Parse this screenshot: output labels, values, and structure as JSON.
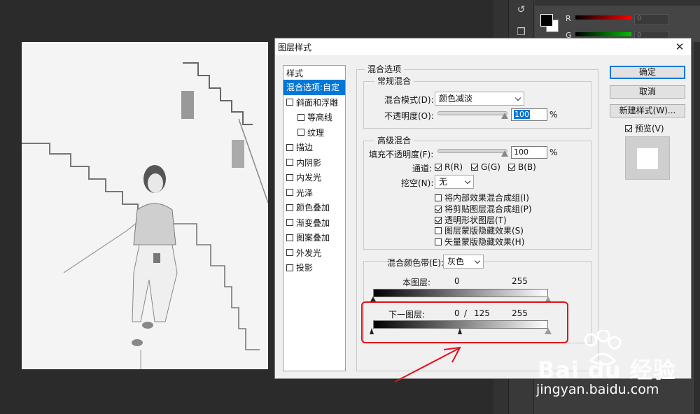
{
  "dialog": {
    "title": "图层样式",
    "close_label": "✕"
  },
  "styles_list": {
    "header": "样式",
    "items": [
      {
        "label": "混合选项:自定",
        "checkbox": false,
        "selected": true,
        "indent": false
      },
      {
        "label": "斜面和浮雕",
        "checkbox": true,
        "checked": false,
        "indent": false
      },
      {
        "label": "等高线",
        "checkbox": true,
        "checked": false,
        "indent": true
      },
      {
        "label": "纹理",
        "checkbox": true,
        "checked": false,
        "indent": true
      },
      {
        "label": "描边",
        "checkbox": true,
        "checked": false,
        "indent": false
      },
      {
        "label": "内阴影",
        "checkbox": true,
        "checked": false,
        "indent": false
      },
      {
        "label": "内发光",
        "checkbox": true,
        "checked": false,
        "indent": false
      },
      {
        "label": "光泽",
        "checkbox": true,
        "checked": false,
        "indent": false
      },
      {
        "label": "颜色叠加",
        "checkbox": true,
        "checked": false,
        "indent": false
      },
      {
        "label": "渐变叠加",
        "checkbox": true,
        "checked": false,
        "indent": false
      },
      {
        "label": "图案叠加",
        "checkbox": true,
        "checked": false,
        "indent": false
      },
      {
        "label": "外发光",
        "checkbox": true,
        "checked": false,
        "indent": false
      },
      {
        "label": "投影",
        "checkbox": true,
        "checked": false,
        "indent": false
      }
    ]
  },
  "blend_options": {
    "title": "混合选项",
    "general": {
      "title": "常规混合",
      "mode_label": "混合模式(D):",
      "mode_value": "颜色减淡",
      "opacity_label": "不透明度(O):",
      "opacity_value": "100",
      "opacity_unit": "%",
      "opacity_level": 1.0
    },
    "advanced": {
      "title": "高级混合",
      "fill_label": "填充不透明度(F):",
      "fill_value": "100",
      "fill_unit": "%",
      "fill_level": 1.0,
      "channels_label": "通道:",
      "channels": [
        {
          "label": "R(R)",
          "checked": true
        },
        {
          "label": "G(G)",
          "checked": true
        },
        {
          "label": "B(B)",
          "checked": true
        }
      ],
      "knockout_label": "挖空(N):",
      "knockout_value": "无",
      "options": [
        {
          "label": "将内部效果混合成组(I)",
          "checked": false
        },
        {
          "label": "将剪贴图层混合成组(P)",
          "checked": true
        },
        {
          "label": "透明形状图层(T)",
          "checked": true
        },
        {
          "label": "图层蒙版隐藏效果(S)",
          "checked": false
        },
        {
          "label": "矢量蒙版隐藏效果(H)",
          "checked": false
        }
      ]
    },
    "blend_if": {
      "label": "混合颜色带(E):",
      "value": "灰色",
      "this_layer_label": "本图层:",
      "this_layer_low": "0",
      "this_layer_high": "255",
      "underlying_label": "下一图层:",
      "underlying_low": "0",
      "underlying_sep": "/",
      "underlying_mid": "125",
      "underlying_high": "255"
    }
  },
  "buttons": {
    "ok": "确定",
    "cancel": "取消",
    "new_style": "新建样式(W)...",
    "preview": "预览(V)",
    "preview_checked": true
  },
  "ps_panel": {
    "channels": [
      "R",
      "G"
    ],
    "values": [
      "0",
      "0"
    ]
  },
  "watermark": {
    "brand": "Bai du 经验",
    "url": "jingyan.baidu.com"
  },
  "colors": {
    "accent": "#0078d7",
    "annotation": "#e0121a"
  }
}
